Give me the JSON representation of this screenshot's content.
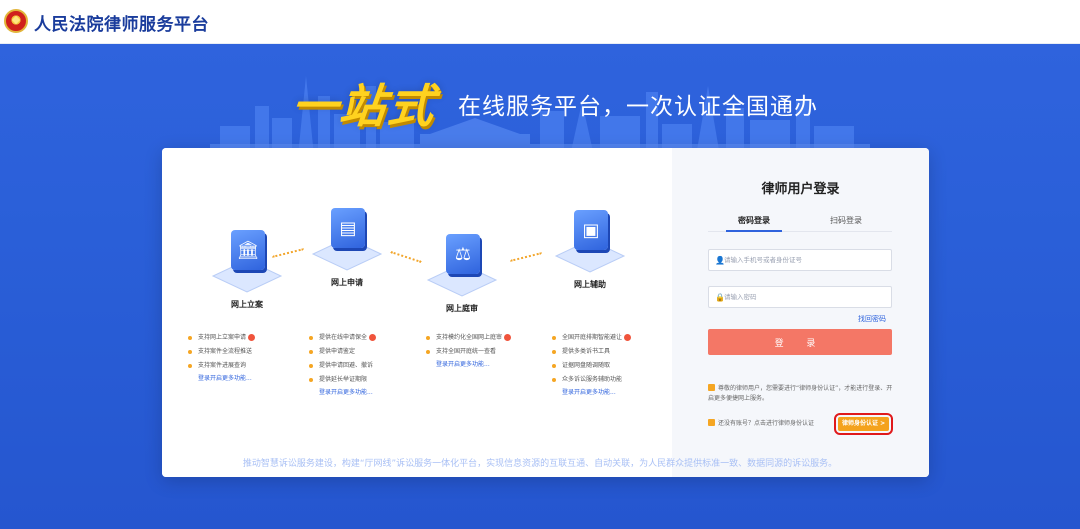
{
  "header": {
    "site_title": "人民法院律师服务平台"
  },
  "hero": {
    "slogan_big": "一站式",
    "slogan_small": "在线服务平台，一次认证全国通办"
  },
  "steps": [
    {
      "title": "网上立案",
      "icon": "court-building-icon",
      "glyph": "🏛"
    },
    {
      "title": "网上申请",
      "icon": "document-icon",
      "glyph": "▤"
    },
    {
      "title": "网上庭审",
      "icon": "gavel-icon",
      "glyph": "⚖"
    },
    {
      "title": "网上辅助",
      "icon": "briefcase-icon",
      "glyph": "▣"
    }
  ],
  "features": [
    {
      "items": [
        "支持网上立案申请",
        "支持案件全流程推送",
        "支持案件进展查询"
      ],
      "more": "登录开启更多功能..."
    },
    {
      "items": [
        "提供在线申请保全",
        "提供申请鉴定",
        "提供申请回避、撤诉",
        "提供延长举证期限"
      ],
      "more": "登录开启更多功能..."
    },
    {
      "items": [
        "支持模约化全国网上庭审",
        "支持全国开庭统一查看"
      ],
      "more": "登录开启更多功能..."
    },
    {
      "items": [
        "全国开庭排期智能避让",
        "提供多类诉书工具",
        "证据网盘随调随取",
        "众多诉讼服务辅助功能"
      ],
      "more": "登录开启更多功能..."
    }
  ],
  "login": {
    "title": "律师用户登录",
    "tab_password": "密码登录",
    "tab_qr": "扫码登录",
    "account_placeholder": "请输入手机号或者身份证号",
    "password_placeholder": "请输入密码",
    "forgot": "找回密码",
    "submit": "登 录",
    "notice": "尊敬的律师用户，您需要进行“律师身份认证”，才能进行登录、开启更多便捷网上服务。",
    "register_prompt": "还没有账号？点击进行律师身份认证",
    "cert_button": "律师身份认证 >"
  },
  "footer": {
    "text": "推动智慧诉讼服务建设，构建“厅网线”诉讼服务一体化平台，实现信息资源的互联互通、自动关联，为人民群众提供标准一致、数据同源的诉讼服务。"
  },
  "colors": {
    "brand_blue": "#2f63dd",
    "slogan_yellow": "#ffd21f",
    "login_button": "#f47766",
    "cert_button": "#f4a21d",
    "highlight_border": "#e0191b"
  }
}
